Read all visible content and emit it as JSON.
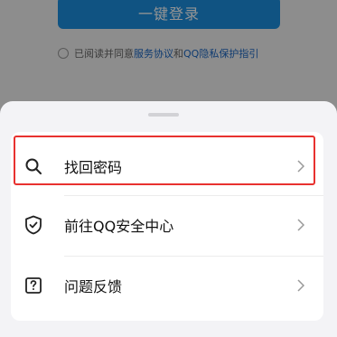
{
  "login": {
    "button_label": "一键登录"
  },
  "agreement": {
    "prefix": "已阅读并同意",
    "service_link": "服务协议",
    "and": "和",
    "privacy_link": "QQ隐私保护指引"
  },
  "sheet": {
    "items": [
      {
        "label": "找回密码",
        "icon": "search-icon"
      },
      {
        "label": "前往QQ安全中心",
        "icon": "shield-check-icon"
      },
      {
        "label": "问题反馈",
        "icon": "question-box-icon"
      }
    ]
  },
  "colors": {
    "primary": "#1c8fe0",
    "link": "#1a66c2",
    "highlight": "#e8312f"
  }
}
